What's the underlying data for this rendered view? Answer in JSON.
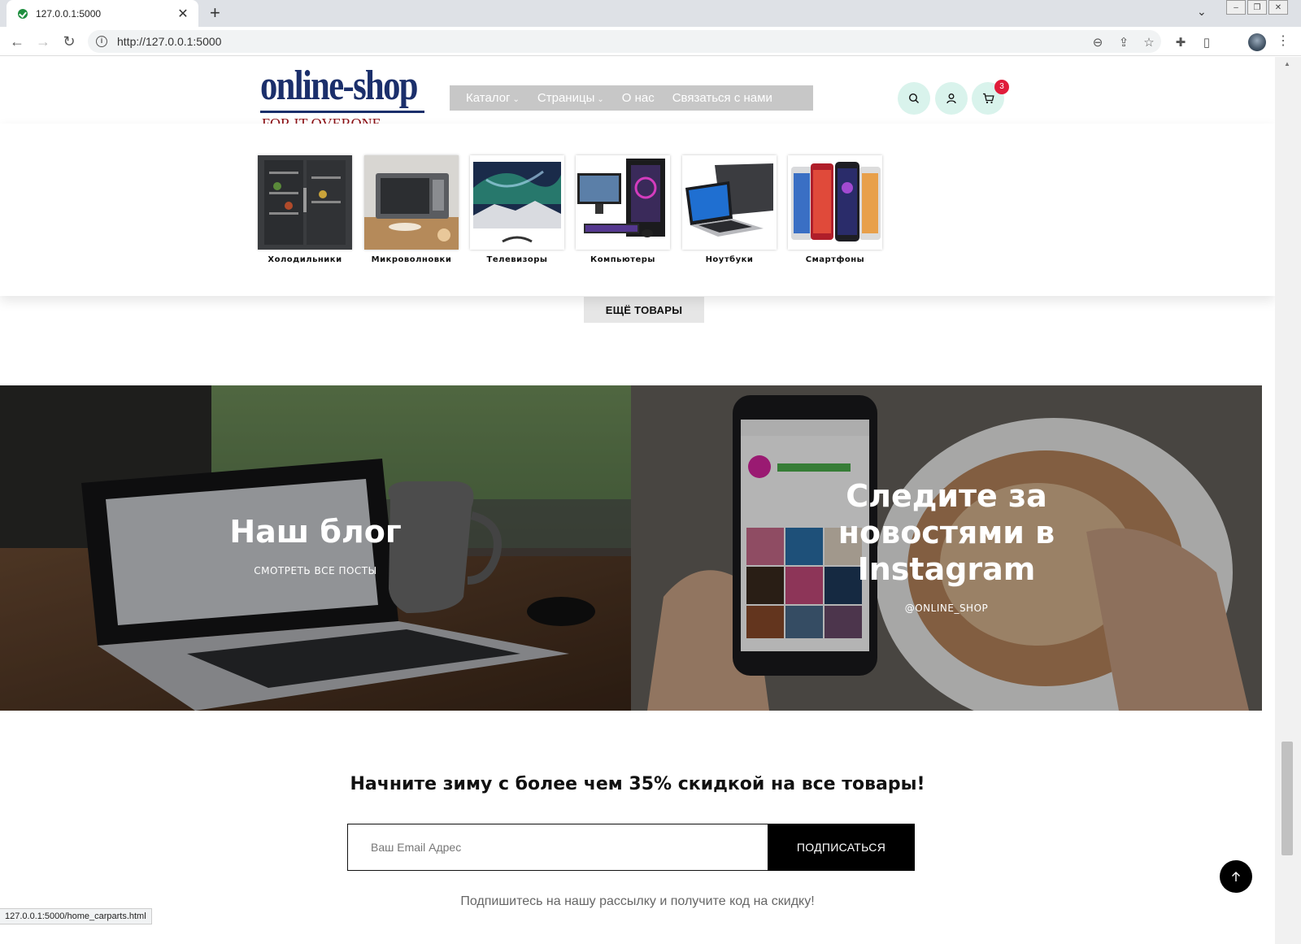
{
  "browser": {
    "tab_title": "127.0.0.1:5000",
    "url": "http://127.0.0.1:5000",
    "status_url": "127.0.0.1:5000/home_carparts.html"
  },
  "header": {
    "logo_main": "online-shop",
    "logo_tagline": "FOR IT OVERONE",
    "nav": [
      {
        "label": "Каталог",
        "dropdown": true
      },
      {
        "label": "Страницы",
        "dropdown": true
      },
      {
        "label": "О нас",
        "dropdown": false
      },
      {
        "label": "Связаться с нами",
        "dropdown": false
      }
    ],
    "cart_count": "3"
  },
  "catalog": {
    "categories": [
      {
        "label": "Холодильники",
        "icon": "fridge"
      },
      {
        "label": "Микроволновки",
        "icon": "microwave"
      },
      {
        "label": "Телевизоры",
        "icon": "tv"
      },
      {
        "label": "Компьютеры",
        "icon": "computer"
      },
      {
        "label": "Ноутбуки",
        "icon": "laptop"
      },
      {
        "label": "Смартфоны",
        "icon": "smartphone"
      }
    ],
    "more_label": "ЕЩЁ ТОВАРЫ"
  },
  "banners": {
    "blog_title": "Наш блог",
    "blog_link": "СМОТРЕТЬ ВСЕ ПОСТЫ",
    "insta_title_1": "Следите за",
    "insta_title_2": "новостями в",
    "insta_title_3": "Instagram",
    "insta_handle": "@ONLINE_SHOP"
  },
  "newsletter": {
    "promo": "Начните зиму с более чем 35% скидкой на все товары!",
    "email_placeholder": "Ваш Email Адрес",
    "subscribe_label": "ПОДПИСАТЬСЯ",
    "note": "Подпишитесь на нашу рассылку и получите код на скидку!"
  },
  "colors": {
    "nav_bg": "#c7c7c7",
    "icon_btn_bg": "#d9f3ec",
    "cart_badge": "#e01c3a",
    "logo_blue": "#1b2f6b",
    "logo_red": "#8b0d12"
  }
}
